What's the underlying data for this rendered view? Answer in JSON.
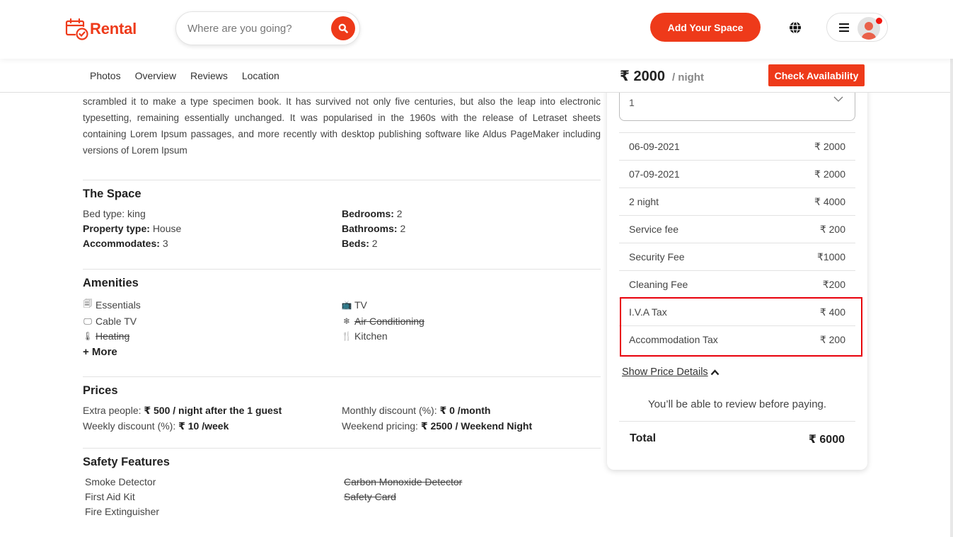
{
  "header": {
    "brand": "Rental",
    "search_placeholder": "Where are you going?",
    "add_space_label": "Add Your Space",
    "brand_color": "#ee3a1a"
  },
  "subnav": {
    "links": [
      "Photos",
      "Overview",
      "Reviews",
      "Location"
    ],
    "price": "₹ 2000",
    "price_unit": "/ night",
    "check_label": "Check Availability"
  },
  "description": "scrambled it to make a type specimen book. It has survived not only five centuries, but also the leap into electronic typesetting, remaining essentially unchanged. It was popularised in the 1960s with the release of Letraset sheets containing Lorem Ipsum passages, and more recently with desktop publishing software like Aldus PageMaker including versions of Lorem Ipsum",
  "space": {
    "title": "The Space",
    "items": [
      {
        "label": "Bed type:",
        "value": "king",
        "bold": false
      },
      {
        "label": "Bedrooms:",
        "value": "2",
        "bold": true
      },
      {
        "label": "Property type:",
        "value": "House",
        "bold": true
      },
      {
        "label": "Bathrooms:",
        "value": "2",
        "bold": true
      },
      {
        "label": "Accommodates:",
        "value": "3",
        "bold": true
      },
      {
        "label": "Beds:",
        "value": "2",
        "bold": true
      }
    ]
  },
  "amenities": {
    "title": "Amenities",
    "items": [
      {
        "icon": "essentials-icon",
        "label": "Essentials",
        "available": true
      },
      {
        "icon": "tv-icon",
        "label": "TV",
        "available": true
      },
      {
        "icon": "cable-tv-icon",
        "label": "Cable TV",
        "available": true
      },
      {
        "icon": "snowflake-icon",
        "label": "Air Conditioning",
        "available": false
      },
      {
        "icon": "thermometer-icon",
        "label": "Heating",
        "available": false
      },
      {
        "icon": "utensils-icon",
        "label": "Kitchen",
        "available": true
      }
    ],
    "more_label": "+ More"
  },
  "prices": {
    "title": "Prices",
    "items": [
      {
        "label": "Extra people:",
        "value": "₹ 500 / night after the 1 guest"
      },
      {
        "label": "Monthly discount (%):",
        "value": "₹ 0 /month"
      },
      {
        "label": "Weekly discount (%):",
        "value": "₹ 10 /week"
      },
      {
        "label": "Weekend pricing:",
        "value": "₹ 2500 / Weekend Night"
      }
    ]
  },
  "safety": {
    "title": "Safety Features",
    "items": [
      {
        "label": "Smoke Detector",
        "available": true
      },
      {
        "label": "Carbon Monoxide Detector",
        "available": false
      },
      {
        "label": "First Aid Kit",
        "available": true
      },
      {
        "label": "Safety Card",
        "available": false
      },
      {
        "label": "Fire Extinguisher",
        "available": true
      }
    ]
  },
  "booking": {
    "guests_value": "1",
    "rows": [
      {
        "label": "06-09-2021",
        "value": "₹ 2000"
      },
      {
        "label": "07-09-2021",
        "value": "₹ 2000"
      },
      {
        "label": "2 night",
        "value": "₹ 4000"
      },
      {
        "label": "Service fee",
        "value": "₹ 200"
      },
      {
        "label": "Security Fee",
        "value": "₹1000"
      },
      {
        "label": "Cleaning Fee",
        "value": "₹200"
      },
      {
        "label": "I.V.A Tax",
        "value": "₹ 400"
      },
      {
        "label": "Accommodation Tax",
        "value": "₹ 200"
      }
    ],
    "show_details_label": "Show Price Details",
    "review_note": "You’ll be able to review before paying.",
    "total_label": "Total",
    "total_value": "₹ 6000",
    "highlight_color": "#e8000b"
  }
}
